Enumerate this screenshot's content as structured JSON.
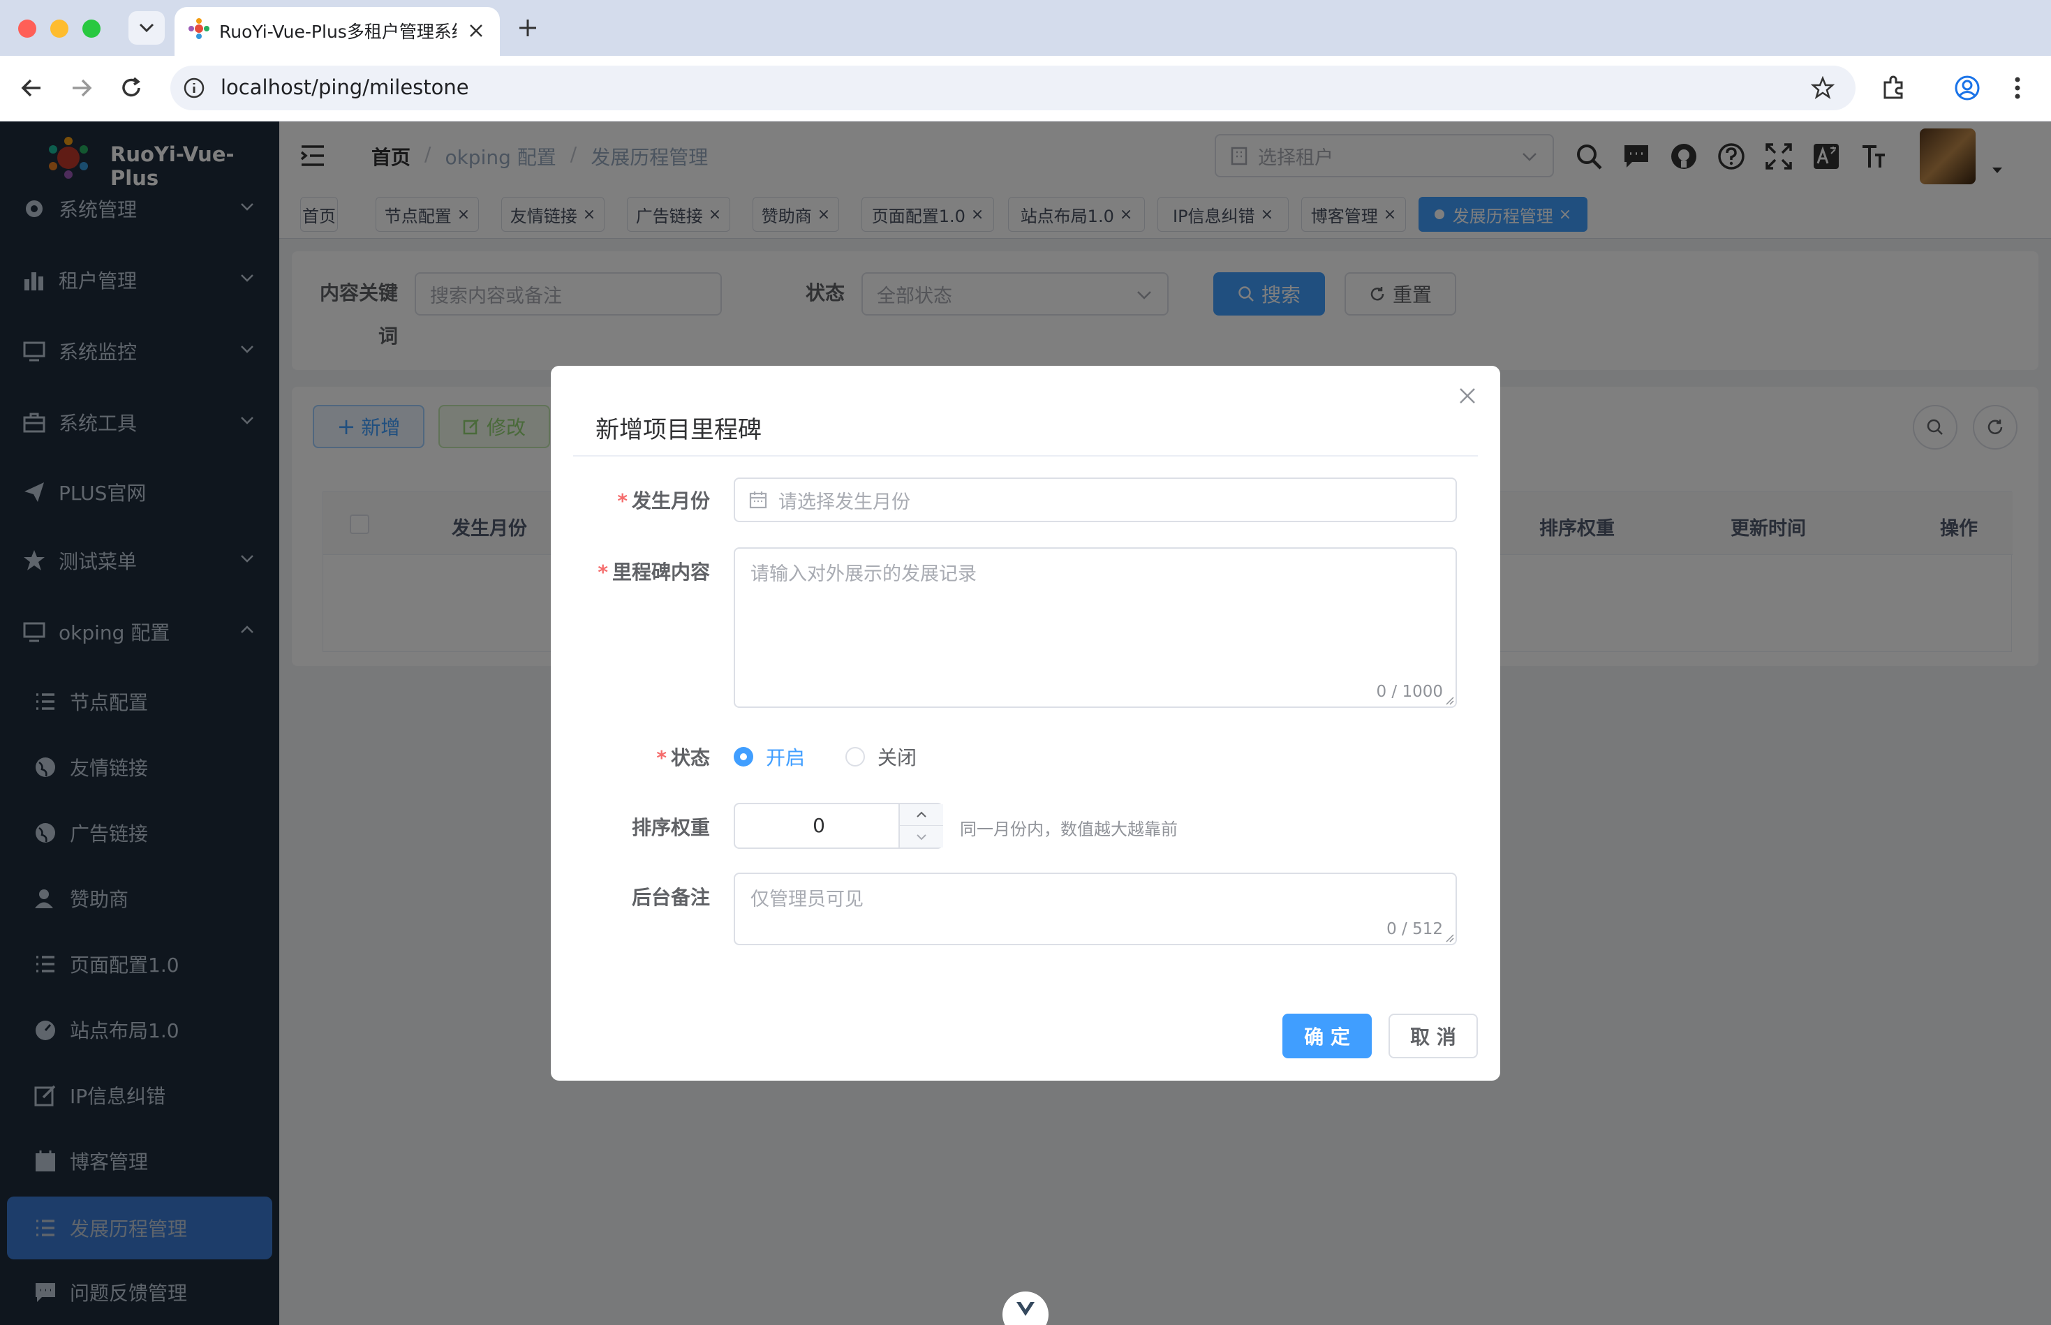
{
  "browser": {
    "tab_title": "RuoYi-Vue-Plus多租户管理系统",
    "url": "localhost/ping/milestone"
  },
  "sidebar": {
    "logo_text": "RuoYi-Vue-Plus",
    "items": [
      {
        "label": "系统管理",
        "icon": "gear-icon"
      },
      {
        "label": "租户管理",
        "icon": "bar-chart-icon"
      },
      {
        "label": "系统监控",
        "icon": "monitor-icon"
      },
      {
        "label": "系统工具",
        "icon": "toolbox-icon"
      },
      {
        "label": "PLUS官网",
        "icon": "paper-plane-icon"
      },
      {
        "label": "测试菜单",
        "icon": "star-icon"
      },
      {
        "label": "okping 配置",
        "icon": "monitor-icon"
      }
    ],
    "sub_items": [
      {
        "label": "节点配置",
        "icon": "list-icon"
      },
      {
        "label": "友情链接",
        "icon": "globe-icon"
      },
      {
        "label": "广告链接",
        "icon": "globe-icon"
      },
      {
        "label": "赞助商",
        "icon": "user-icon"
      },
      {
        "label": "页面配置1.0",
        "icon": "list-icon"
      },
      {
        "label": "站点布局1.0",
        "icon": "dashboard-icon"
      },
      {
        "label": "IP信息纠错",
        "icon": "edit-icon"
      },
      {
        "label": "博客管理",
        "icon": "calendar-icon"
      },
      {
        "label": "发展历程管理",
        "icon": "list-icon"
      },
      {
        "label": "问题反馈管理",
        "icon": "chat-icon"
      }
    ]
  },
  "navbar": {
    "breadcrumb": [
      "首页",
      "okping 配置",
      "发展历程管理"
    ],
    "tenant_placeholder": "选择租户"
  },
  "tags": [
    {
      "label": "首页",
      "closable": false
    },
    {
      "label": "节点配置",
      "closable": true
    },
    {
      "label": "友情链接",
      "closable": true
    },
    {
      "label": "广告链接",
      "closable": true
    },
    {
      "label": "赞助商",
      "closable": true
    },
    {
      "label": "页面配置1.0",
      "closable": true
    },
    {
      "label": "站点布局1.0",
      "closable": true
    },
    {
      "label": "IP信息纠错",
      "closable": true
    },
    {
      "label": "博客管理",
      "closable": true
    },
    {
      "label": "发展历程管理",
      "closable": true,
      "active": true
    }
  ],
  "search": {
    "keyword_label_1": "内容关键",
    "keyword_label_2": "词",
    "keyword_placeholder": "搜索内容或备注",
    "status_label": "状态",
    "status_placeholder": "全部状态",
    "search_button": "搜索",
    "reset_button": "重置"
  },
  "toolbar": {
    "add_button": "新增",
    "edit_button": "修改"
  },
  "table": {
    "columns": [
      "发生月份",
      "排序权重",
      "更新时间",
      "操作"
    ]
  },
  "dialog": {
    "title": "新增项目里程碑",
    "month_label": "发生月份",
    "month_placeholder": "请选择发生月份",
    "content_label": "里程碑内容",
    "content_placeholder": "请输入对外展示的发展记录",
    "content_counter": "0 / 1000",
    "status_label": "状态",
    "status_options": [
      "开启",
      "关闭"
    ],
    "status_selected": "开启",
    "sort_label": "排序权重",
    "sort_value": "0",
    "sort_hint": "同一月份内，数值越大越靠前",
    "remark_label": "后台备注",
    "remark_placeholder": "仅管理员可见",
    "remark_counter": "0 / 512",
    "confirm_button": "确 定",
    "cancel_button": "取 消"
  },
  "colors": {
    "primary": "#409eff",
    "sidebar_bg": "#1f2d3d",
    "danger": "#f56c6c"
  }
}
